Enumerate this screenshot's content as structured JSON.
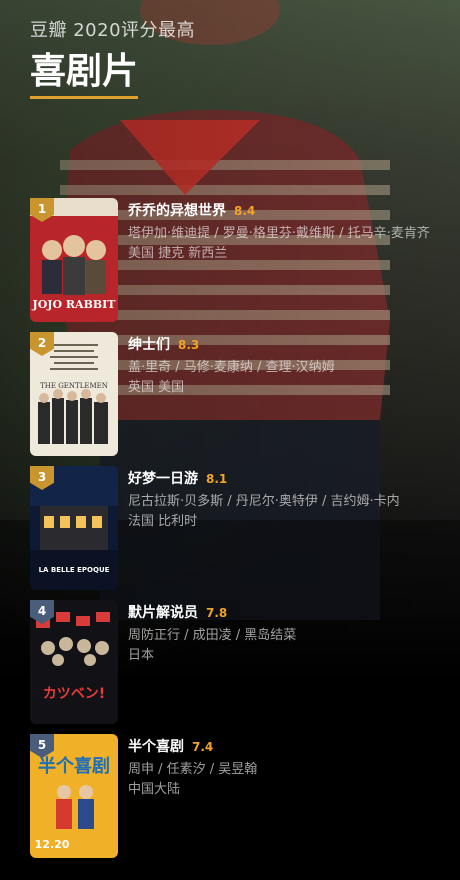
{
  "header": {
    "subtitle": "豆瓣 2020评分最高",
    "title": "喜剧片"
  },
  "colors": {
    "accent": "#f2a227",
    "underline": "#e0a030",
    "rank_badge": "#c8952f",
    "rank_badge_dark": "#4a5d7a"
  },
  "movies": [
    {
      "rank": "1",
      "title": "乔乔的异想世界",
      "score": "8.4",
      "cast": "塔伊加·维迪提 / 罗曼·格里芬·戴维斯 / 托马辛·麦肯齐",
      "countries": "美国 捷克 新西兰",
      "poster_text": "JOJO RABBIT"
    },
    {
      "rank": "2",
      "title": "绅士们",
      "score": "8.3",
      "cast": "盖·里奇 / 马修·麦康纳 / 查理·汉纳姆",
      "countries": "英国 美国",
      "poster_text": "THE GENTLEMEN"
    },
    {
      "rank": "3",
      "title": "好梦一日游",
      "score": "8.1",
      "cast": "尼古拉斯·贝多斯 / 丹尼尔·奥特伊 / 吉约姆·卡内",
      "countries": "法国 比利时",
      "poster_text": "LA BELLE EPOQUE"
    },
    {
      "rank": "4",
      "title": "默片解说员",
      "score": "7.8",
      "cast": "周防正行 / 成田凌 / 黑岛结菜",
      "countries": "日本",
      "poster_text": "カツベン!"
    },
    {
      "rank": "5",
      "title": "半个喜剧",
      "score": "7.4",
      "cast": "周申 / 任素汐 / 吴昱翰",
      "countries": "中国大陆",
      "poster_text": "半个喜剧",
      "poster_date": "12.20"
    }
  ]
}
